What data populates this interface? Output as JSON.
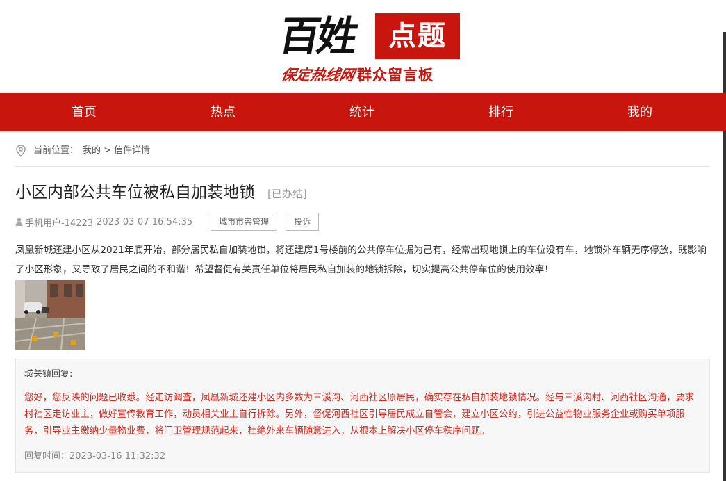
{
  "logo": {
    "main_text": "百姓",
    "box_text": "点题",
    "sub_script": "保定热线网",
    "sub_text": "群众留言板"
  },
  "nav": [
    "首页",
    "热点",
    "统计",
    "排行",
    "我的"
  ],
  "breadcrumb": {
    "prefix": "当前位置：",
    "parent": "我的",
    "separator": ">",
    "current": "信件详情"
  },
  "letter": {
    "title": "小区内部公共车位被私自加装地锁",
    "status": "[已办结]",
    "user": "手机用户-14223",
    "datetime": "2023-03-07 16:54:35",
    "category": "城市市容管理",
    "complain_label": "投诉",
    "body": "凤凰新城还建小区从2021年底开始，部分居民私自加装地锁，将还建房1号楼前的公共停车位据为己有，经常出现地锁上的车位没有车，地锁外车辆无序停放，既影响了小区形象，又导致了居民之间的不和谐！希望督促有关责任单位将居民私自加装的地锁拆除，切实提高公共停车位的使用效率！"
  },
  "reply": {
    "header": "城关镇回复:",
    "body": "您好，您反映的问题已收悉。经走访调查，凤凰新城还建小区内多数为三溪沟、河西社区原居民，确实存在私自加装地锁情况。经与三溪沟村、河西社区沟通，要求村社区走访业主，做好宣传教育工作，动员相关业主自行拆除。另外，督促河西社区引导居民成立自管会，建立小区公约，引进公益性物业服务企业或购买单项服务，引导业主缴纳少量物业费，将门卫管理规范起来，杜绝外来车辆随意进入，从根本上解决小区停车秩序问题。",
    "time_label": "回复时间：",
    "time": "2023-03-16 11:32:32"
  },
  "colors": {
    "brand_red": "#c8160e",
    "reply_red": "#d22a1e"
  }
}
